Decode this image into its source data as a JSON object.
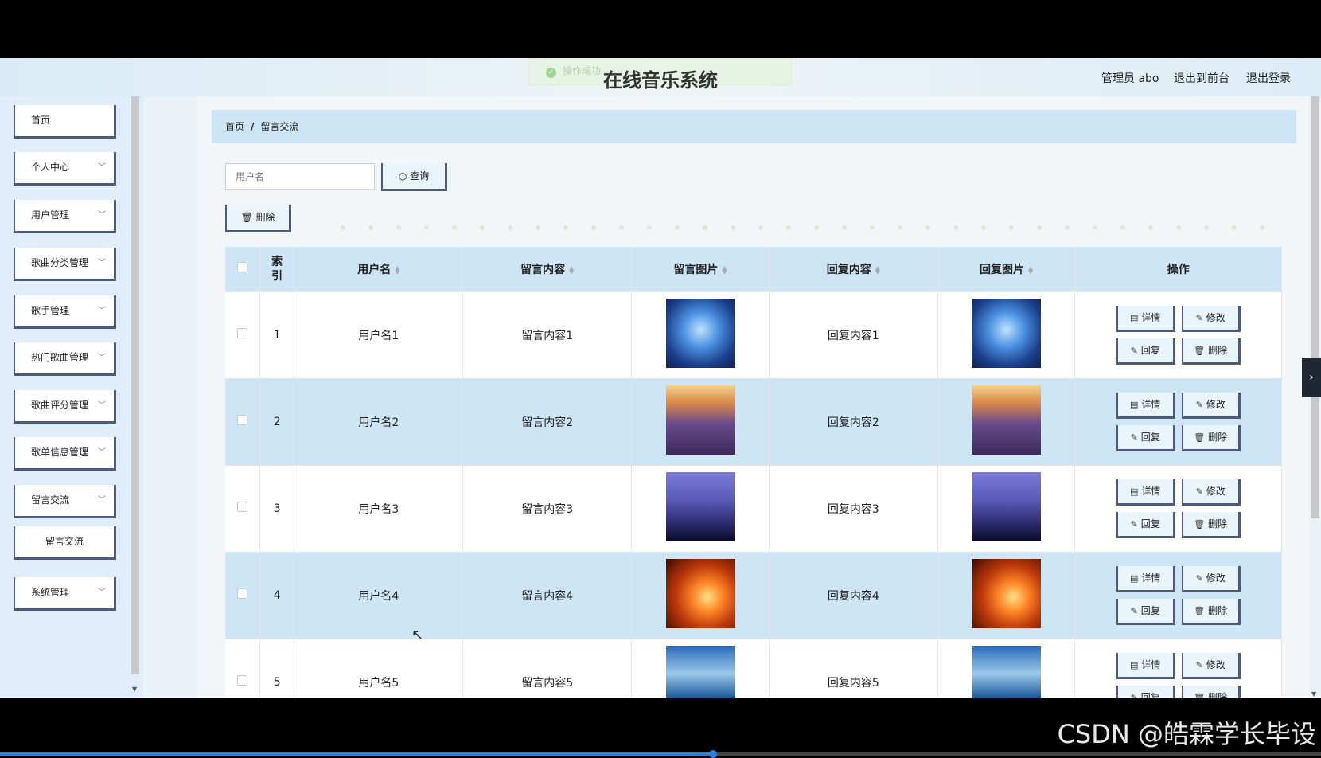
{
  "header": {
    "toast": "操作成功",
    "title": "在线音乐系统",
    "admin": "管理员 abo",
    "to_front": "退出到前台",
    "logout": "退出登录"
  },
  "sidebar": {
    "items": [
      {
        "label": "首页",
        "expandable": false
      },
      {
        "label": "个人中心",
        "expandable": true
      },
      {
        "label": "用户管理",
        "expandable": true
      },
      {
        "label": "歌曲分类管理",
        "expandable": true
      },
      {
        "label": "歌手管理",
        "expandable": true
      },
      {
        "label": "热门歌曲管理",
        "expandable": true
      },
      {
        "label": "歌曲评分管理",
        "expandable": true
      },
      {
        "label": "歌单信息管理",
        "expandable": true
      },
      {
        "label": "留言交流",
        "expandable": true
      },
      {
        "label": "留言交流",
        "expandable": false,
        "submenu": true
      },
      {
        "label": "系统管理",
        "expandable": true
      }
    ]
  },
  "breadcrumb": {
    "home": "首页",
    "separator": "/",
    "current": "留言交流"
  },
  "search": {
    "placeholder": "用户名",
    "button": "查询"
  },
  "toolbar": {
    "delete": "删除"
  },
  "table": {
    "columns": [
      "索引",
      "用户名",
      "留言内容",
      "留言图片",
      "回复内容",
      "回复图片",
      "操作"
    ],
    "rows": [
      {
        "index": "1",
        "username": "用户名1",
        "content": "留言内容1",
        "reply": "回复内容1",
        "img": "blue-sky-person"
      },
      {
        "index": "2",
        "username": "用户名2",
        "content": "留言内容2",
        "reply": "回复内容2",
        "img": "lavender-sunset"
      },
      {
        "index": "3",
        "username": "用户名3",
        "content": "留言内容3",
        "reply": "回复内容3",
        "img": "pier-night"
      },
      {
        "index": "4",
        "username": "用户名4",
        "content": "留言内容4",
        "reply": "回复内容4",
        "img": "fiery-sunset-tree"
      },
      {
        "index": "5",
        "username": "用户名5",
        "content": "留言内容5",
        "reply": "回复内容5",
        "img": "mountain-lake"
      }
    ],
    "actions": {
      "detail": "详情",
      "edit": "修改",
      "reply": "回复",
      "delete": "删除"
    }
  },
  "watermark": "CSDN @皓霖学长毕设",
  "video_progress": 0.54,
  "colors": {
    "accent": "#cde5f5",
    "button_border": "#4d5a7a",
    "sidebar_bg": "#dfeefa"
  }
}
